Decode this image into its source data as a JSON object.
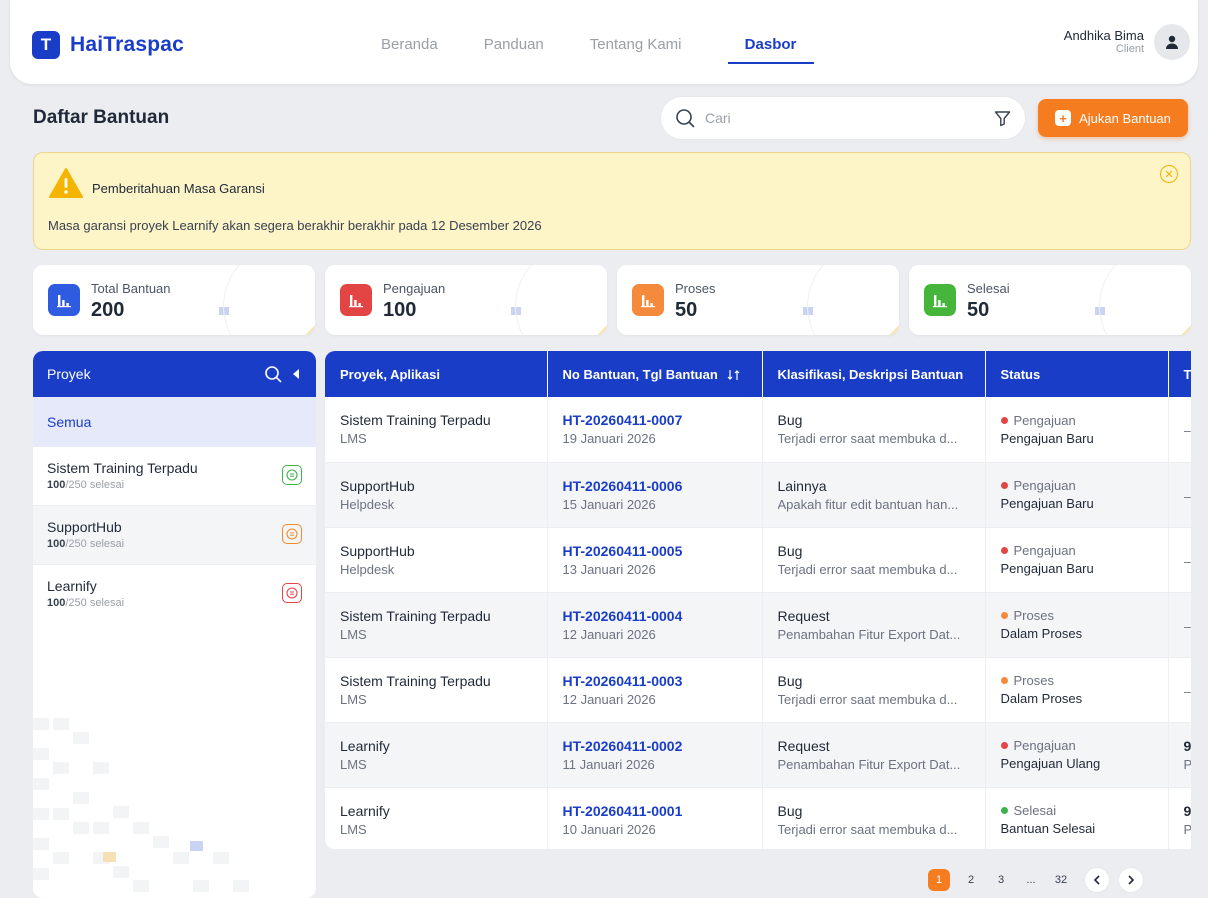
{
  "brand": {
    "logo_letter": "T",
    "name": "HaiTraspac",
    "color": "#1a3dc8"
  },
  "nav": [
    {
      "label": "Beranda",
      "active": false
    },
    {
      "label": "Panduan",
      "active": false
    },
    {
      "label": "Tentang Kami",
      "active": false
    },
    {
      "label": "Dasbor",
      "active": true
    }
  ],
  "user": {
    "name": "Andhika Bima",
    "role": "Client"
  },
  "page": {
    "title": "Daftar Bantuan"
  },
  "search": {
    "placeholder": "Cari"
  },
  "actions": {
    "submit_label": "Ajukan Bantuan",
    "accent": "#f57c1f"
  },
  "alert": {
    "title": "Pemberitahuan Masa Garansi",
    "body": "Masa garansi proyek Learnify akan segera berakhir berakhir pada 12 Desember 2026"
  },
  "stats": [
    {
      "label": "Total Bantuan",
      "value": "200",
      "color": "#2f5be0",
      "icon": "bar-chart-icon"
    },
    {
      "label": "Pengajuan",
      "value": "100",
      "color": "#e34545",
      "icon": "bar-chart-icon"
    },
    {
      "label": "Proses",
      "value": "50",
      "color": "#f58a3c",
      "icon": "bar-chart-icon"
    },
    {
      "label": "Selesai",
      "value": "50",
      "color": "#45b53b",
      "icon": "bar-chart-icon"
    }
  ],
  "projects": {
    "header": "Proyek",
    "all_label": "Semua",
    "items": [
      {
        "name": "Sistem Training Terpadu",
        "done": "100",
        "total_suffix": "/250 selesai",
        "badge_color": "#3bb34a"
      },
      {
        "name": "SupportHub",
        "done": "100",
        "total_suffix": "/250 selesai",
        "badge_color": "#f08a2c"
      },
      {
        "name": "Learnify",
        "done": "100",
        "total_suffix": "/250 selesai",
        "badge_color": "#e34545"
      }
    ]
  },
  "table": {
    "columns": [
      "Proyek, Aplikasi",
      "No Bantuan, Tgl Bantuan",
      "Klasifikasi, Deskripsi Bantuan",
      "Status",
      "T"
    ],
    "rows": [
      {
        "project": "Sistem Training Terpadu",
        "app": "LMS",
        "ticket": "HT-20260411-0007",
        "date": "19 Januari 2026",
        "class": "Bug",
        "desc": "Terjadi error saat membuka d...",
        "status": "Pengajuan",
        "status_color": "#e34545",
        "status_sub": "Pengajuan Baru",
        "extra": "–",
        "extra_sub": ""
      },
      {
        "project": "SupportHub",
        "app": "Helpdesk",
        "ticket": "HT-20260411-0006",
        "date": "15 Januari 2026",
        "class": "Lainnya",
        "desc": "Apakah fitur edit bantuan han...",
        "status": "Pengajuan",
        "status_color": "#e34545",
        "status_sub": "Pengajuan Baru",
        "extra": "–",
        "extra_sub": ""
      },
      {
        "project": "SupportHub",
        "app": "Helpdesk",
        "ticket": "HT-20260411-0005",
        "date": "13 Januari 2026",
        "class": "Bug",
        "desc": "Terjadi error saat membuka d...",
        "status": "Pengajuan",
        "status_color": "#e34545",
        "status_sub": "Pengajuan Baru",
        "extra": "–",
        "extra_sub": ""
      },
      {
        "project": "Sistem Training Terpadu",
        "app": "LMS",
        "ticket": "HT-20260411-0004",
        "date": "12 Januari 2026",
        "class": "Request",
        "desc": "Penambahan Fitur Export Dat...",
        "status": "Proses",
        "status_color": "#f58a3c",
        "status_sub": "Dalam Proses",
        "extra": "–",
        "extra_sub": ""
      },
      {
        "project": "Sistem Training Terpadu",
        "app": "LMS",
        "ticket": "HT-20260411-0003",
        "date": "12 Januari 2026",
        "class": "Bug",
        "desc": "Terjadi error saat membuka d...",
        "status": "Proses",
        "status_color": "#f58a3c",
        "status_sub": "Dalam Proses",
        "extra": "–",
        "extra_sub": ""
      },
      {
        "project": "Learnify",
        "app": "LMS",
        "ticket": "HT-20260411-0002",
        "date": "11 Januari 2026",
        "class": "Request",
        "desc": "Penambahan Fitur Export Dat...",
        "status": "Pengajuan",
        "status_color": "#e34545",
        "status_sub": "Pengajuan Ulang",
        "extra": "9",
        "extra_sub": "P"
      },
      {
        "project": "Learnify",
        "app": "LMS",
        "ticket": "HT-20260411-0001",
        "date": "10 Januari 2026",
        "class": "Bug",
        "desc": "Terjadi error saat membuka d...",
        "status": "Selesai",
        "status_color": "#3bb34a",
        "status_sub": "Bantuan Selesai",
        "extra": "9",
        "extra_sub": "P"
      }
    ]
  },
  "pagination": {
    "current": "1",
    "pages": [
      "2",
      "3",
      "...",
      "32"
    ]
  }
}
